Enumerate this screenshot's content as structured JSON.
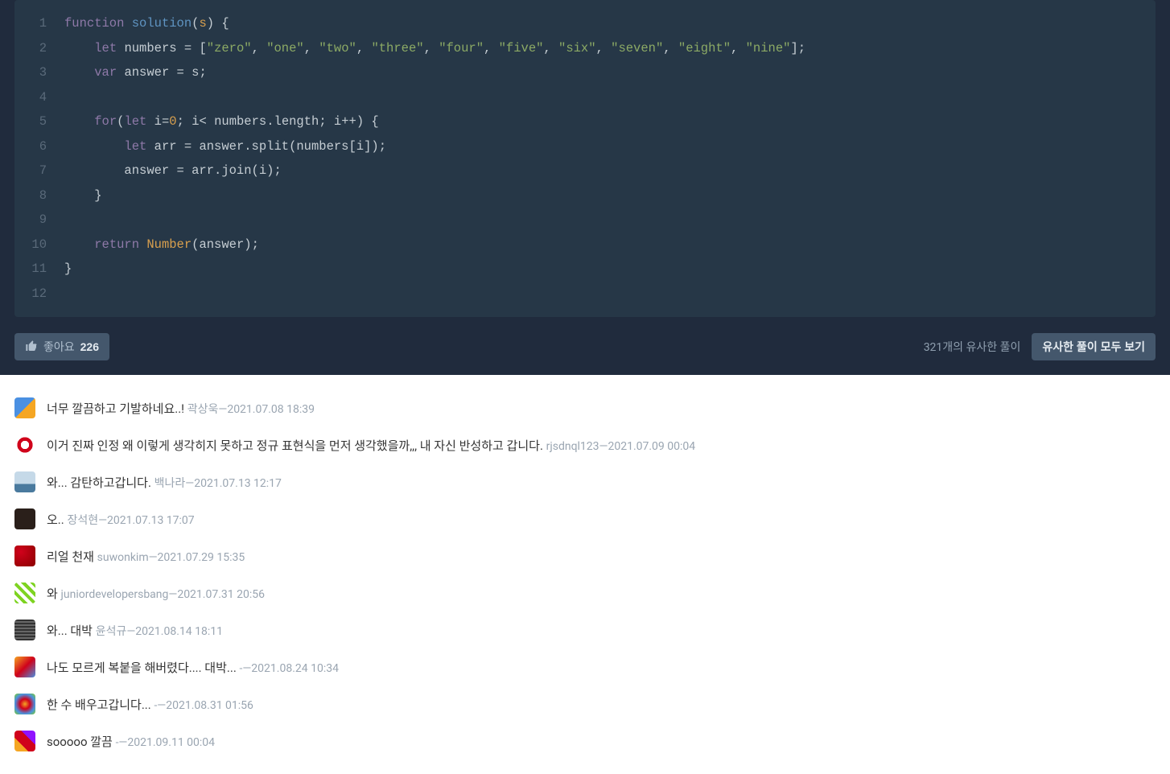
{
  "code": {
    "lines": [
      {
        "num": "1",
        "content": [
          [
            "kw-function",
            "function"
          ],
          [
            "punct",
            " "
          ],
          [
            "fn-name",
            "solution"
          ],
          [
            "punct",
            "("
          ],
          [
            "param",
            "s"
          ],
          [
            "punct",
            ") {"
          ]
        ]
      },
      {
        "num": "2",
        "content": [
          [
            "punct",
            "    "
          ],
          [
            "kw-let",
            "let"
          ],
          [
            "punct",
            " "
          ],
          [
            "ident",
            "numbers"
          ],
          [
            "punct",
            " = ["
          ],
          [
            "str",
            "\"zero\""
          ],
          [
            "punct",
            ", "
          ],
          [
            "str",
            "\"one\""
          ],
          [
            "punct",
            ", "
          ],
          [
            "str",
            "\"two\""
          ],
          [
            "punct",
            ", "
          ],
          [
            "str",
            "\"three\""
          ],
          [
            "punct",
            ", "
          ],
          [
            "str",
            "\"four\""
          ],
          [
            "punct",
            ", "
          ],
          [
            "str",
            "\"five\""
          ],
          [
            "punct",
            ", "
          ],
          [
            "str",
            "\"six\""
          ],
          [
            "punct",
            ", "
          ],
          [
            "str",
            "\"seven\""
          ],
          [
            "punct",
            ", "
          ],
          [
            "str",
            "\"eight\""
          ],
          [
            "punct",
            ", "
          ],
          [
            "str",
            "\"nine\""
          ],
          [
            "punct",
            "];"
          ]
        ]
      },
      {
        "num": "3",
        "content": [
          [
            "punct",
            "    "
          ],
          [
            "kw-var",
            "var"
          ],
          [
            "punct",
            " "
          ],
          [
            "ident",
            "answer"
          ],
          [
            "punct",
            " = s;"
          ]
        ]
      },
      {
        "num": "4",
        "content": []
      },
      {
        "num": "5",
        "content": [
          [
            "punct",
            "    "
          ],
          [
            "kw-for",
            "for"
          ],
          [
            "punct",
            "("
          ],
          [
            "kw-let",
            "let"
          ],
          [
            "punct",
            " "
          ],
          [
            "ident",
            "i"
          ],
          [
            "punct",
            "="
          ],
          [
            "num",
            "0"
          ],
          [
            "punct",
            "; i< numbers.length; i++) {"
          ]
        ]
      },
      {
        "num": "6",
        "content": [
          [
            "punct",
            "        "
          ],
          [
            "kw-let",
            "let"
          ],
          [
            "punct",
            " "
          ],
          [
            "ident",
            "arr"
          ],
          [
            "punct",
            " = answer.split(numbers[i]);"
          ]
        ]
      },
      {
        "num": "7",
        "content": [
          [
            "punct",
            "        answer = arr.join(i);"
          ]
        ]
      },
      {
        "num": "8",
        "content": [
          [
            "punct",
            "    }"
          ]
        ]
      },
      {
        "num": "9",
        "content": []
      },
      {
        "num": "10",
        "content": [
          [
            "punct",
            "    "
          ],
          [
            "kw-return",
            "return"
          ],
          [
            "punct",
            " "
          ],
          [
            "call",
            "Number"
          ],
          [
            "punct",
            "(answer);"
          ]
        ]
      },
      {
        "num": "11",
        "content": [
          [
            "punct",
            "}"
          ]
        ]
      },
      {
        "num": "12",
        "content": []
      }
    ]
  },
  "actions": {
    "like_label": "좋아요",
    "like_count": "226",
    "similar_count_text": "321개의 유사한 풀이",
    "similar_all_label": "유사한 풀이 모두 보기"
  },
  "comments": [
    {
      "avatarClass": "avatar-0",
      "text": "너무 깔끔하고 기발하네요..!",
      "meta": "곽상욱―2021.07.08 18:39"
    },
    {
      "avatarClass": "avatar-1",
      "text": "이거 진짜 인정 왜 이렇게 생각히지 못하고 정규 표현식을 먼저 생각했을까,,, 내 자신 반성하고 갑니다.",
      "meta": "rjsdnql123―2021.07.09 00:04"
    },
    {
      "avatarClass": "avatar-2",
      "text": "와... 감탄하고갑니다.",
      "meta": "백나라―2021.07.13 12:17"
    },
    {
      "avatarClass": "avatar-3",
      "text": "오..",
      "meta": "장석현―2021.07.13 17:07"
    },
    {
      "avatarClass": "avatar-4",
      "text": "리얼 천재",
      "meta": "suwonkim―2021.07.29 15:35"
    },
    {
      "avatarClass": "avatar-5",
      "text": "와",
      "meta": "juniordevelopersbang―2021.07.31 20:56"
    },
    {
      "avatarClass": "avatar-6",
      "text": "와... 대박",
      "meta": "윤석규―2021.08.14 18:11"
    },
    {
      "avatarClass": "avatar-7",
      "text": "나도 모르게 복붙을 해버렸다.... 대박...",
      "meta": "-―2021.08.24 10:34"
    },
    {
      "avatarClass": "avatar-8",
      "text": "한 수 배우고갑니다...",
      "meta": "-―2021.08.31 01:56"
    },
    {
      "avatarClass": "avatar-9",
      "text": "sooooo 깔끔",
      "meta": "-―2021.09.11 00:04"
    }
  ]
}
